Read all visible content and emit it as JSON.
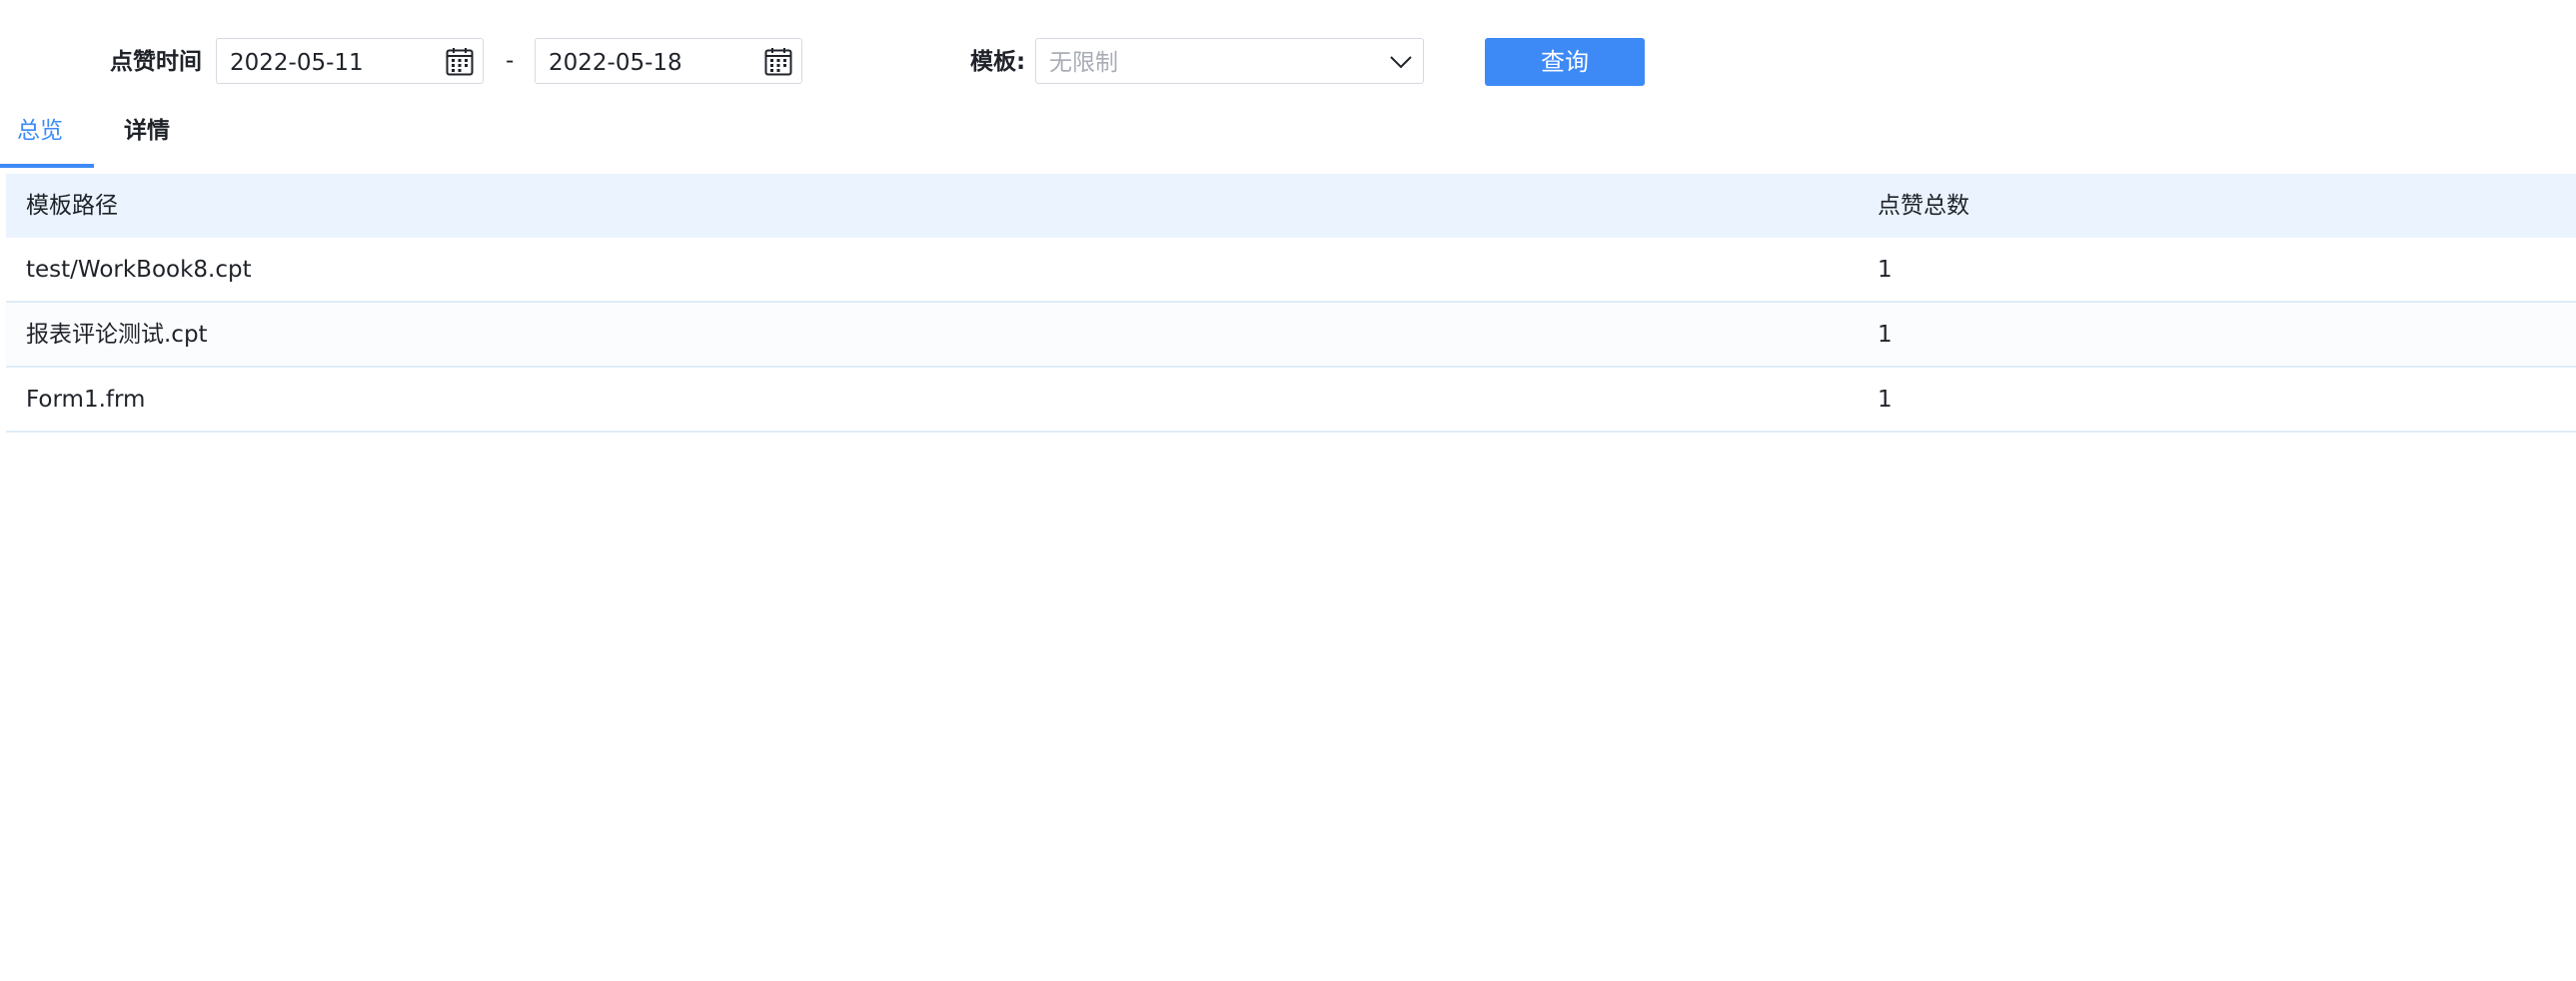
{
  "filter": {
    "like_time_label": "点赞时间",
    "start_date": "2022-05-11",
    "end_date": "2022-05-18",
    "range_separator": "-",
    "template_label": "模板:",
    "template_placeholder": "无限制",
    "query_button": "查询"
  },
  "tabs": [
    {
      "label": "总览",
      "active": true
    },
    {
      "label": "详情",
      "active": false
    }
  ],
  "table": {
    "columns": [
      "模板路径",
      "点赞总数"
    ],
    "rows": [
      [
        "test/WorkBook8.cpt",
        "1"
      ],
      [
        "报表评论测试.cpt",
        "1"
      ],
      [
        "Form1.frm",
        "1"
      ]
    ]
  },
  "colors": {
    "accent": "#3d8af6",
    "header_bg": "#ebf3fe",
    "row_border": "#dfecf7"
  }
}
